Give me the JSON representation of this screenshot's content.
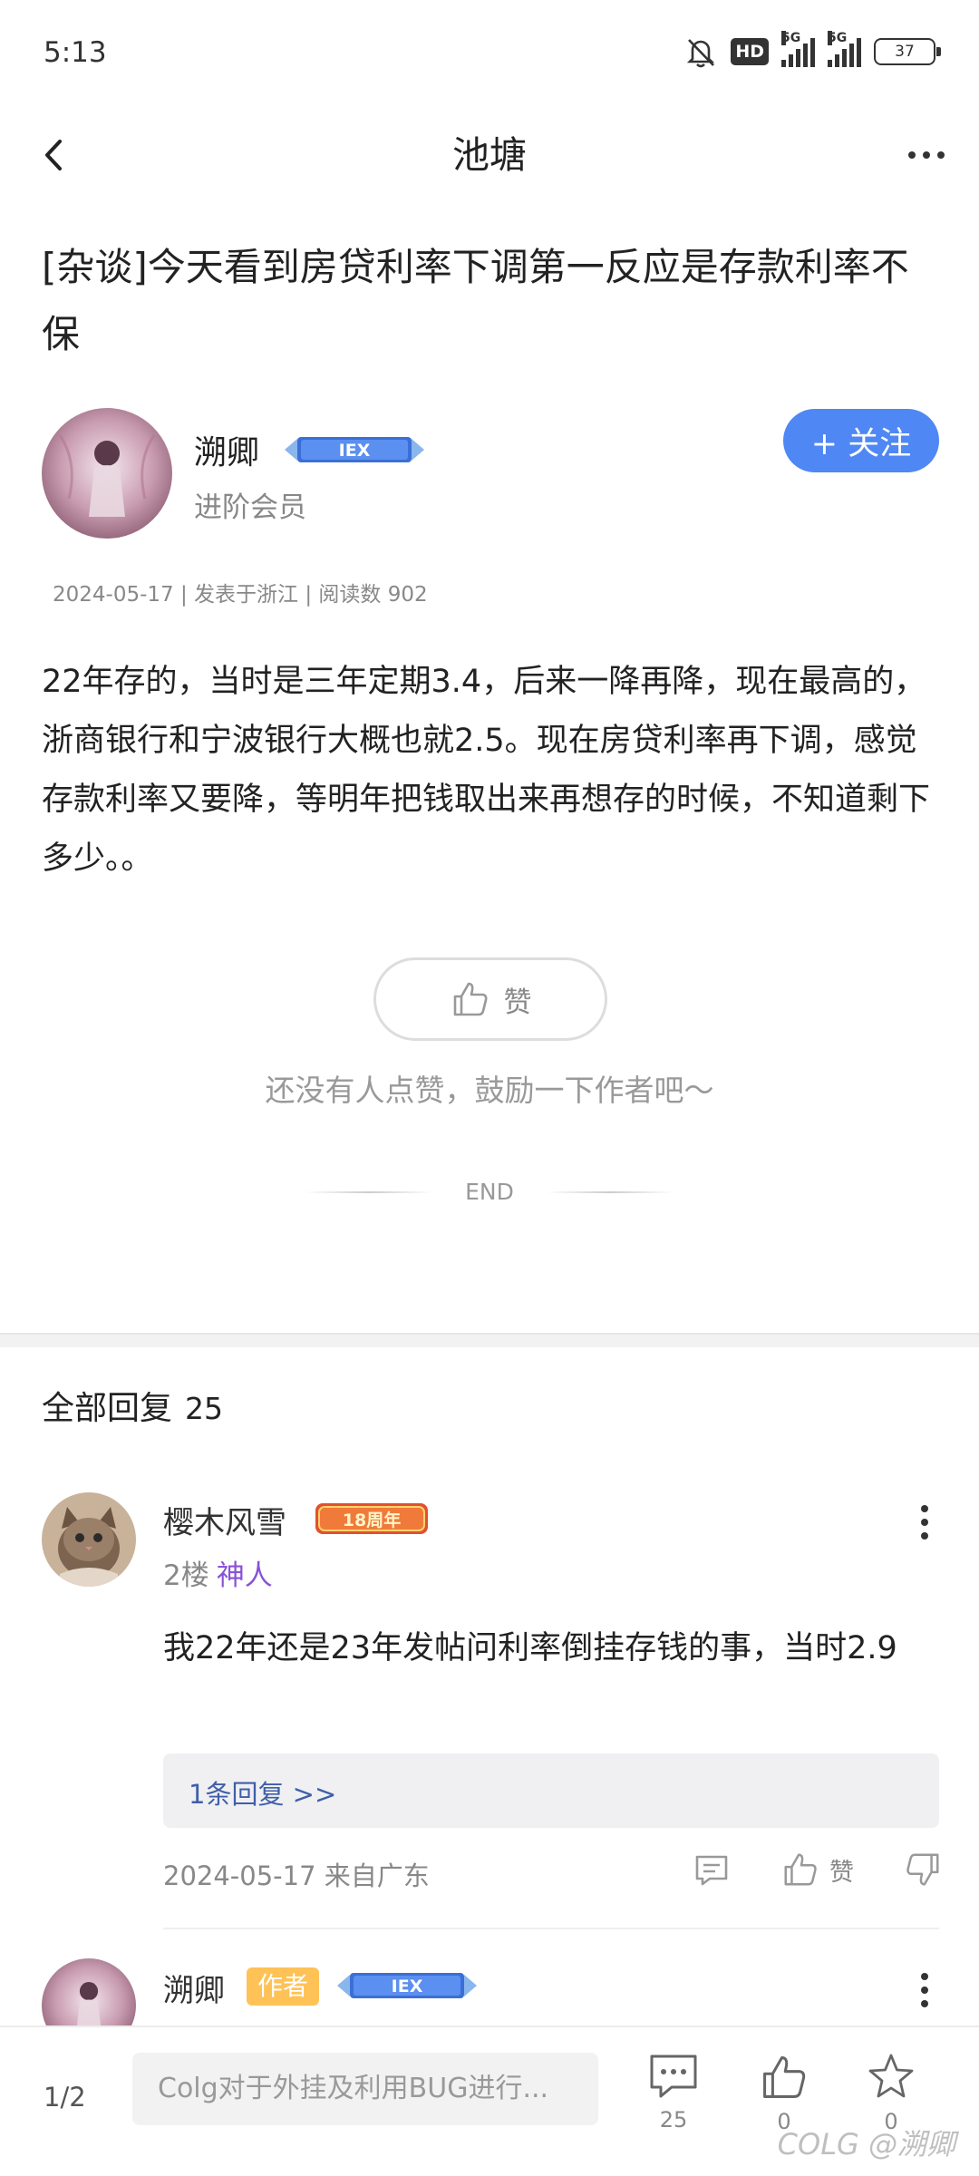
{
  "status_bar": {
    "time": "5:13",
    "hd": "HD",
    "network1": "5G",
    "network2": "5G",
    "battery": "37"
  },
  "nav": {
    "title": "池塘"
  },
  "post": {
    "title": "[杂谈]今天看到房贷利率下调第一反应是存款利率不保",
    "author": {
      "name": "溯卿",
      "badge_text": "IEX",
      "level": "进阶会员"
    },
    "follow_label": "+ 关注",
    "meta": "2024-05-17 | 发表于浙江 | 阅读数 902",
    "body": "22年存的，当时是三年定期3.4，后来一降再降，现在最高的，浙商银行和宁波银行大概也就2.5。现在房贷利率再下调，感觉存款利率又要降，等明年把钱取出来再想存的时候，不知道剩下多少。。",
    "like_label": "赞",
    "like_hint": "还没有人点赞，鼓励一下作者吧～",
    "end_label": "END"
  },
  "replies": {
    "header_label": "全部回复",
    "count": "25",
    "items": [
      {
        "name": "樱木风雪",
        "badge_text": "18周年",
        "floor": "2楼",
        "user_title": "神人",
        "content": "我22年还是23年发帖问利率倒挂存钱的事，当时2.9",
        "sub_reply_label": "1条回复 >>",
        "date": "2024-05-17 来自广东",
        "like_label": "赞"
      },
      {
        "name": "溯卿",
        "author_tag": "作者",
        "badge_text": "IEX"
      }
    ]
  },
  "bottom_bar": {
    "page_indicator": "1/2",
    "input_placeholder": "Colg对于外挂及利用BUG进行...",
    "comment_count": "25",
    "like_count": "0",
    "favorite_count": "0",
    "watermark": "COLG @溯卿"
  },
  "colors": {
    "accent": "#4f87f5",
    "user_title": "#8a52d6",
    "sub_reply_link": "#3f5fa8",
    "author_tag": "#ffc256"
  }
}
